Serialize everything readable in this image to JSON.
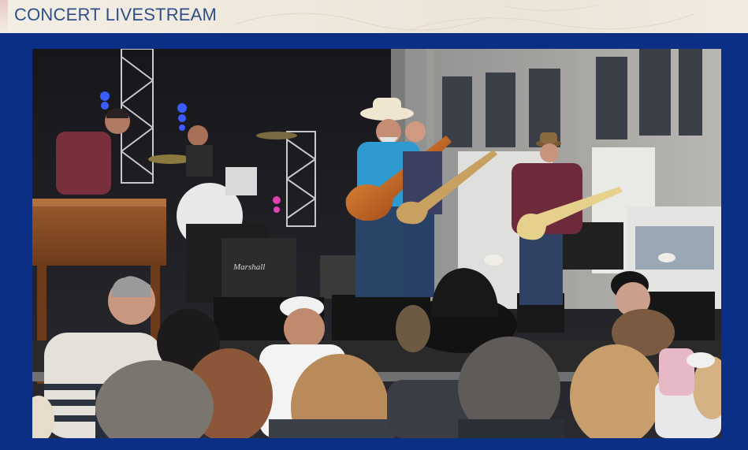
{
  "header": {
    "title": "CONCERT LIVESTREAM"
  },
  "player": {
    "content": "live-concert-video",
    "playing": true
  },
  "colors": {
    "frame_blue": "#0c2f86",
    "title_blue": "#2e4f86",
    "header_bg": "#efe8dc"
  }
}
